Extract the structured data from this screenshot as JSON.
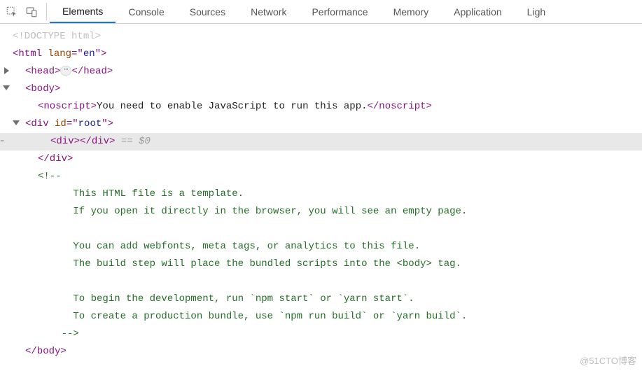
{
  "toolbar": {
    "icons": [
      "inspect",
      "device-toggle"
    ],
    "tabs": [
      {
        "label": "Elements",
        "active": true
      },
      {
        "label": "Console",
        "active": false
      },
      {
        "label": "Sources",
        "active": false
      },
      {
        "label": "Network",
        "active": false
      },
      {
        "label": "Performance",
        "active": false
      },
      {
        "label": "Memory",
        "active": false
      },
      {
        "label": "Application",
        "active": false
      },
      {
        "label": "Ligh",
        "active": false
      }
    ]
  },
  "dom": {
    "doctype": "<!DOCTYPE html>",
    "html_open": {
      "tag": "html",
      "attr": "lang",
      "val": "en"
    },
    "head_open": {
      "tag": "head"
    },
    "head_close": "</head>",
    "body_open": {
      "tag": "body"
    },
    "noscript": {
      "tag": "noscript",
      "text": "You need to enable JavaScript to run this app.",
      "close": "</noscript>"
    },
    "root_div": {
      "tag": "div",
      "attr": "id",
      "val": "root"
    },
    "inner_div_open": "<div>",
    "inner_div_close": "</div>",
    "selection_hint": " == $0",
    "root_close": "</div>",
    "comment_open": "<!--",
    "comment_lines": [
      "      This HTML file is a template.",
      "      If you open it directly in the browser, you will see an empty page.",
      "",
      "      You can add webfonts, meta tags, or analytics to this file.",
      "      The build step will place the bundled scripts into the <body> tag.",
      "",
      "      To begin the development, run `npm start` or `yarn start`.",
      "      To create a production bundle, use `npm run build` or `yarn build`.",
      "    -->"
    ],
    "body_close": "</body>"
  },
  "watermark": "@51CTO博客"
}
